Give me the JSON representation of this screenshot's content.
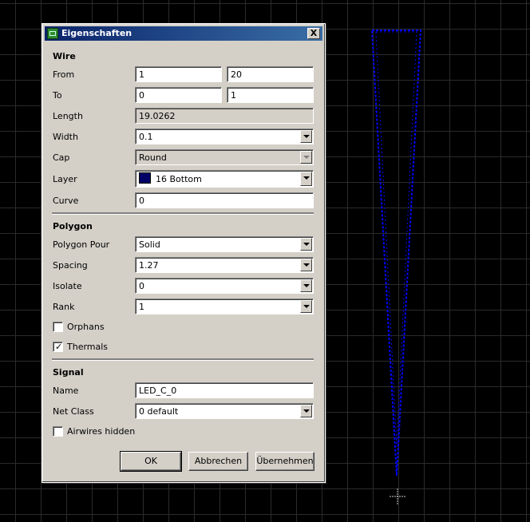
{
  "dialog": {
    "title": "Eigenschaften",
    "close_label": "X",
    "wire": {
      "section": "Wire",
      "from_label": "From",
      "from_x": "1",
      "from_y": "20",
      "to_label": "To",
      "to_x": "0",
      "to_y": "1",
      "length_label": "Length",
      "length_value": "19.0262",
      "width_label": "Width",
      "width_value": "0.1",
      "cap_label": "Cap",
      "cap_value": "Round",
      "layer_label": "Layer",
      "layer_value": "16 Bottom",
      "layer_color": "#000066",
      "curve_label": "Curve",
      "curve_value": "0"
    },
    "polygon": {
      "section": "Polygon",
      "pour_label": "Polygon Pour",
      "pour_value": "Solid",
      "spacing_label": "Spacing",
      "spacing_value": "1.27",
      "isolate_label": "Isolate",
      "isolate_value": "0",
      "rank_label": "Rank",
      "rank_value": "1",
      "orphans_label": "Orphans",
      "orphans_checked": false,
      "thermals_label": "Thermals",
      "thermals_checked": true
    },
    "signal": {
      "section": "Signal",
      "name_label": "Name",
      "name_value": "LED_C_0",
      "netclass_label": "Net Class",
      "netclass_value": "0 default",
      "airwires_label": "Airwires hidden",
      "airwires_checked": false
    },
    "buttons": {
      "ok": "OK",
      "cancel": "Abbrechen",
      "apply": "Übernehmen"
    }
  },
  "canvas": {
    "background": "#000000",
    "grid_color": "#2b2b2b",
    "wire_color": "#0000ff",
    "checkmark": "✓"
  }
}
